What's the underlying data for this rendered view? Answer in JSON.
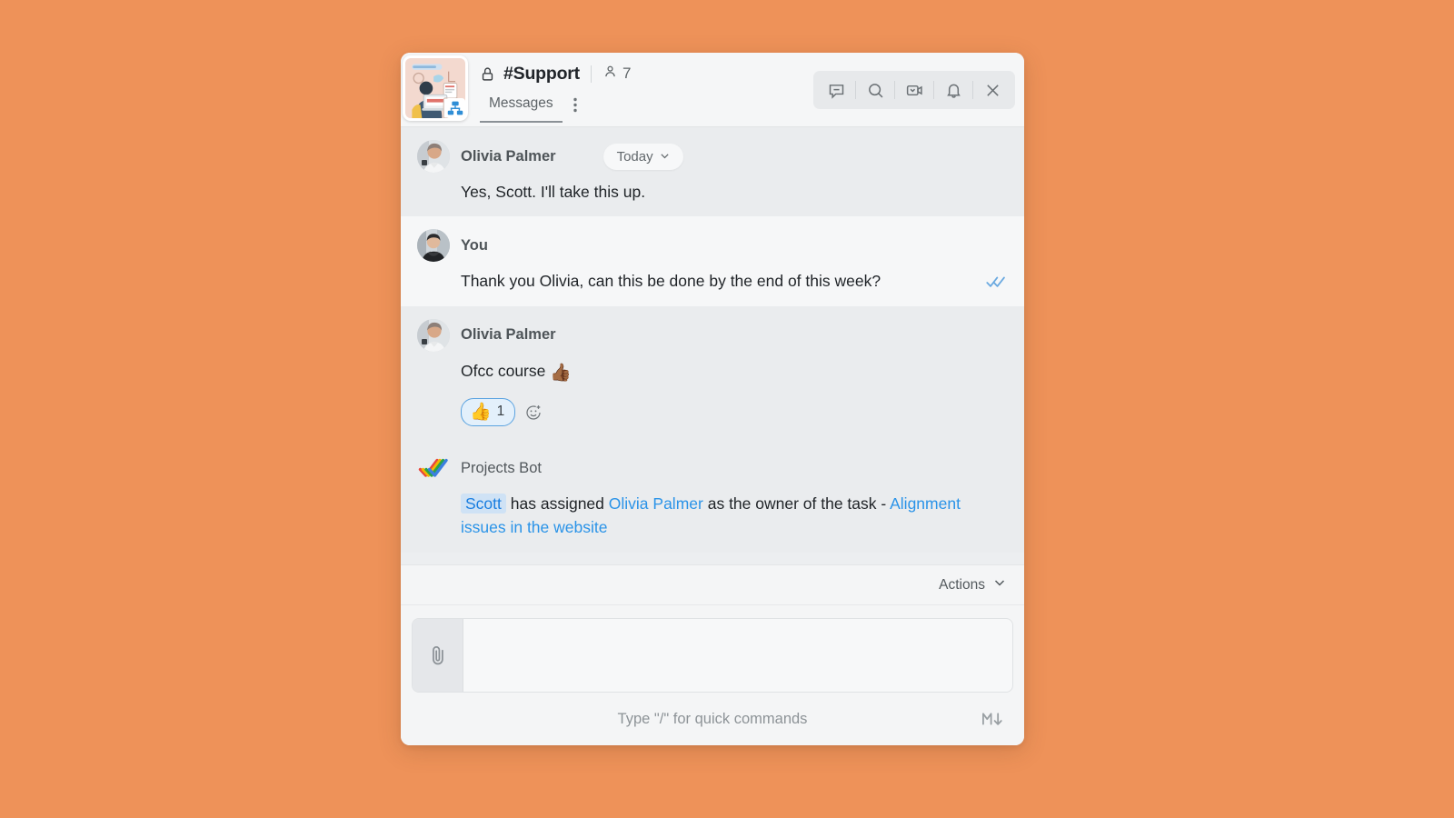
{
  "theme": {
    "page_background": "#ee9259",
    "window_background": "#f2f3f4",
    "accent_blue": "#2a93e8",
    "reaction_border": "#5ba3e0",
    "mention_background": "#cfe2f5",
    "read_receipt_color": "#6aa9e0"
  },
  "header": {
    "thumbnail_icon": "channel-illustration",
    "lock_icon": "lock-icon",
    "channel_name": "#Support",
    "members_icon": "person-icon",
    "member_count": "7",
    "tabs": [
      {
        "label": "Messages",
        "active": true
      }
    ],
    "kebab_icon": "more-vertical-icon",
    "actions": [
      {
        "name": "minimize-chat-icon",
        "icon": "chat-bubble-minus-icon"
      },
      {
        "name": "search-icon",
        "icon": "magnifier-icon"
      },
      {
        "name": "video-call-icon",
        "icon": "video-camera-chevron-icon"
      },
      {
        "name": "notifications-icon",
        "icon": "bell-icon"
      },
      {
        "name": "close-icon",
        "icon": "x-icon"
      }
    ]
  },
  "date_pill": {
    "label": "Today",
    "chevron_icon": "chevron-down-icon"
  },
  "messages": [
    {
      "sender": "Olivia Palmer",
      "avatar": "olivia-avatar",
      "text": "Yes, Scott. I'll take this up.",
      "highlight": false,
      "has_date_pill": true
    },
    {
      "sender": "You",
      "avatar": "you-avatar",
      "text": "Thank you Olivia, can this be done by the end of this week?",
      "highlight": true,
      "read_receipt": "double-check-icon"
    },
    {
      "sender": "Olivia Palmer",
      "avatar": "olivia-avatar",
      "text": "Ofcc course",
      "emoji": "👍🏾",
      "highlight": false,
      "reaction": {
        "emoji": "👍",
        "count": "1",
        "add_icon": "add-reaction-icon"
      }
    },
    {
      "sender": "Projects Bot",
      "avatar": "projects-bot-logo",
      "is_bot": true,
      "highlight": false,
      "parts": {
        "mention": "Scott",
        "text_1": "has assigned",
        "link_1": "Olivia Palmer",
        "text_2": "as the owner of the task -",
        "link_2": "Alignment issues in the website"
      }
    }
  ],
  "footer": {
    "actions_label": "Actions",
    "actions_chevron_icon": "chevron-down-icon",
    "attach_icon": "paperclip-icon",
    "compose_value": "",
    "compose_placeholder": "",
    "hint": "Type \"/\" for quick commands",
    "markdown_icon": "markdown-icon",
    "markdown_glyph": "M↓"
  }
}
